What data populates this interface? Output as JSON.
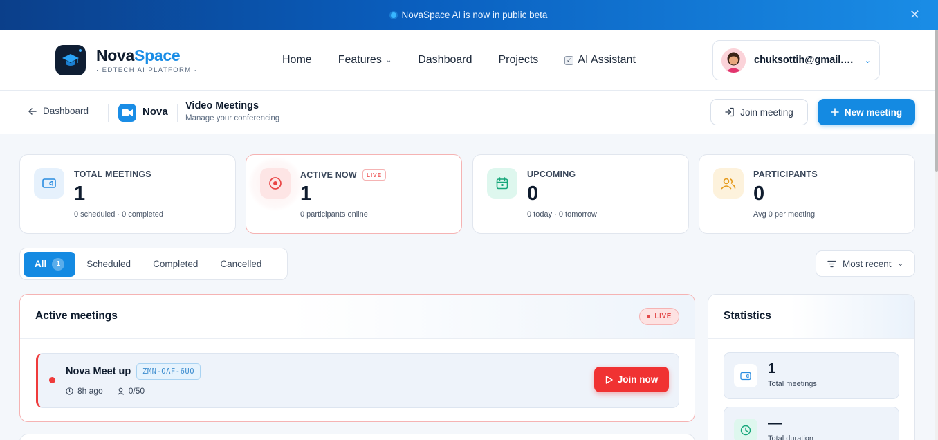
{
  "banner": {
    "text": "NovaSpace AI is now in public beta",
    "close": "✕"
  },
  "brand": {
    "name_part1": "Nova",
    "name_part2": "Space",
    "tagline": "· EDTECH AI PLATFORM ·"
  },
  "nav": {
    "home": "Home",
    "features": "Features",
    "dashboard": "Dashboard",
    "projects": "Projects",
    "ai_assistant": "AI Assistant"
  },
  "user": {
    "email": "chuksottih@gmail.com"
  },
  "subbar": {
    "back_label": "Dashboard",
    "app_label": "Nova",
    "title": "Video Meetings",
    "subtitle": "Manage your conferencing",
    "join_label": "Join meeting",
    "new_label": "New meeting"
  },
  "stats_cards": [
    {
      "label": "TOTAL MEETINGS",
      "value": "1",
      "sub": "0 scheduled · 0 completed"
    },
    {
      "label": "ACTIVE NOW",
      "tag": "LIVE",
      "value": "1",
      "sub": "0 participants online"
    },
    {
      "label": "UPCOMING",
      "value": "0",
      "sub": "0 today · 0 tomorrow"
    },
    {
      "label": "PARTICIPANTS",
      "value": "0",
      "sub": "Avg 0 per meeting"
    }
  ],
  "tabs": [
    {
      "label": "All",
      "count": "1"
    },
    {
      "label": "Scheduled"
    },
    {
      "label": "Completed"
    },
    {
      "label": "Cancelled"
    }
  ],
  "sort": {
    "label": "Most recent"
  },
  "active_panel": {
    "title": "Active meetings",
    "live": "LIVE",
    "meeting": {
      "name": "Nova Meet up",
      "code": "ZMN-OAF-6UO",
      "time": "8h ago",
      "participants": "0/50",
      "join_label": "Join now"
    }
  },
  "statistics": {
    "title": "Statistics",
    "items": [
      {
        "value": "1",
        "label": "Total meetings"
      },
      {
        "value": "—",
        "label": "Total duration"
      }
    ]
  },
  "colors": {
    "primary": "#148ae2",
    "live": "#f03232",
    "dark": "#0f1c2e"
  }
}
